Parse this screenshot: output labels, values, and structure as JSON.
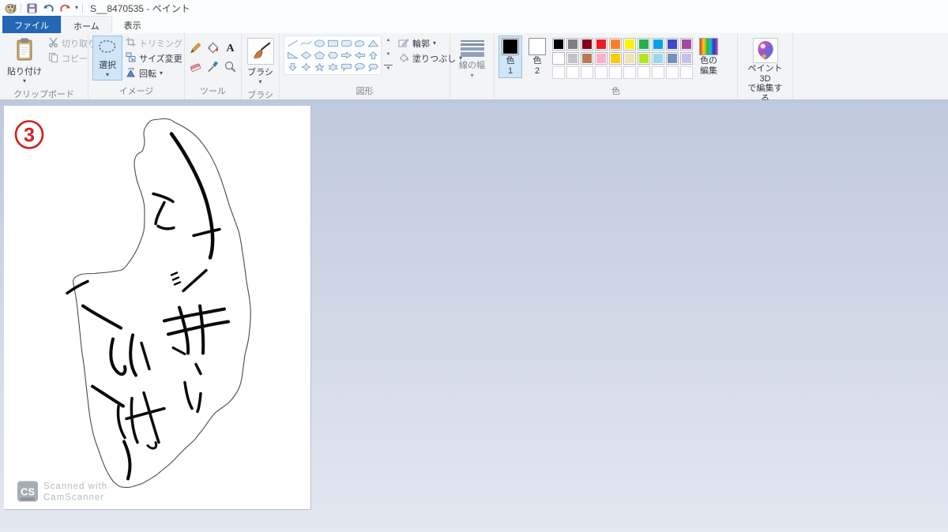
{
  "window": {
    "title": "S__8470535 - ペイント"
  },
  "tabs": {
    "file": "ファイル",
    "home": "ホーム",
    "view": "表示"
  },
  "ribbon": {
    "clipboard": {
      "label": "クリップボード",
      "paste": "貼り付け",
      "cut": "切り取り",
      "copy": "コピー"
    },
    "image": {
      "label": "イメージ",
      "select": "選択",
      "crop": "トリミング",
      "resize": "サイズ変更",
      "rotate": "回転"
    },
    "tools": {
      "label": "ツール"
    },
    "brush": {
      "label": "ブラシ"
    },
    "shapes": {
      "label": "図形",
      "outline": "輪郭",
      "fill": "塗りつぶし"
    },
    "line_width": {
      "label": "線の幅"
    },
    "colors": {
      "label": "色",
      "color1_line1": "色",
      "color1_line2": "1",
      "color2_line1": "色",
      "color2_line2": "2",
      "edit_line1": "色の",
      "edit_line2": "編集",
      "palette_row1": [
        "#000000",
        "#7F7F7F",
        "#880015",
        "#ED1C24",
        "#FF7F27",
        "#FFF200",
        "#22B14C",
        "#00A2E8",
        "#3F48CC",
        "#A349A4"
      ],
      "palette_row2": [
        "#FFFFFF",
        "#C3C3C3",
        "#B97A57",
        "#FFAEC9",
        "#FFC90E",
        "#EFE4B0",
        "#B5E61D",
        "#99D9EA",
        "#7092BE",
        "#C8BFE7"
      ]
    },
    "paint3d": {
      "line1": "ペイント 3D",
      "line2": "で編集する"
    }
  },
  "canvas": {
    "marker": "3",
    "watermark": {
      "badge": "CS",
      "line1": "Scanned with",
      "line2": "CamScanner"
    }
  }
}
